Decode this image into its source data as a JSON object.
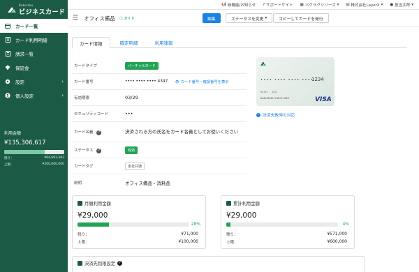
{
  "sidebar": {
    "brand_small": "Bakuraku",
    "brand": "ビジネスカード",
    "items": [
      {
        "label": "カード一覧",
        "icon": "card-icon",
        "active": true
      },
      {
        "label": "カード利用明細",
        "icon": "receipt-icon"
      },
      {
        "label": "請求一覧",
        "icon": "invoice-icon"
      },
      {
        "label": "保証金",
        "icon": "deposit-icon"
      },
      {
        "label": "設定",
        "icon": "gear-icon"
      },
      {
        "label": "個人設定",
        "icon": "person-icon"
      }
    ],
    "usage": {
      "label": "利用金額",
      "amount": "¥135,306,617",
      "fill_fraction": 0.67,
      "remaining_label": "残り：",
      "remaining_value": "¥64,693,383",
      "limit_label": "上限：",
      "limit_value": "¥200,000,000"
    }
  },
  "topbar": {
    "items": [
      {
        "label": "新機能/お知らせ",
        "icon": "megaphone-icon"
      },
      {
        "label": "サポートサイト",
        "icon": "help-icon"
      },
      {
        "label": "バクラクシリーズ",
        "icon": "grid-icon"
      },
      {
        "label": "株式会社LayerX",
        "icon": "building-icon"
      },
      {
        "label": "担当太郎",
        "icon": "user-icon"
      }
    ]
  },
  "header": {
    "title": "オフィス備品",
    "guide": "ガイド",
    "edit": "編集",
    "status_change": "ステータスを変更",
    "copy_issue": "コピーしてカードを発行"
  },
  "tabs": [
    "カード情報",
    "確定明細",
    "利用速報"
  ],
  "card_info": {
    "type_label": "カードタイプ",
    "type_value": "バーチャルカード",
    "number_label": "カード番号",
    "number_value": "•••• •••• •••• 4347",
    "show_number": "カード番号・確認番号を表示",
    "expiry_label": "有効期限",
    "expiry_value": "03/29",
    "cvc_label": "セキュリティコード",
    "cvc_value": "•••",
    "name_label": "カード名義",
    "name_value": "決済される方の氏名をカード名義としてお使いください",
    "status_label": "ステータス",
    "status_value": "有効",
    "tag_label": "カードタグ",
    "tag_value": "全社共通",
    "desc_label": "説明",
    "desc_value": "オフィス備品・消耗品"
  },
  "card_preview": {
    "number": "•••• •••• •••• ••••",
    "last4": "1234",
    "expiry": "01/01",
    "cvc": "123",
    "holder": "BAKURAKU TAROH BEE",
    "brand": "VISA",
    "settle_link": "決済失敗時の対応"
  },
  "monthly": {
    "title": "月間利用金額",
    "amount": "¥29,000",
    "percent_text": "28%",
    "fill_fraction": 0.28,
    "remaining_label": "残り：",
    "remaining_value": "¥71,000",
    "limit_label": "上限：",
    "limit_value": "¥100,000"
  },
  "cumulative": {
    "title": "累計利用金額",
    "amount": "¥29,000",
    "percent_text": "4%",
    "fill_fraction": 0.04,
    "remaining_label": "残り：",
    "remaining_value": "¥571,000",
    "limit_label": "上限：",
    "limit_value": "¥600,000"
  },
  "restriction": {
    "title": "決済先制限設定"
  },
  "colors": {
    "brand": "#1b5b45",
    "primary": "#1a82e2",
    "success": "#23a455"
  }
}
